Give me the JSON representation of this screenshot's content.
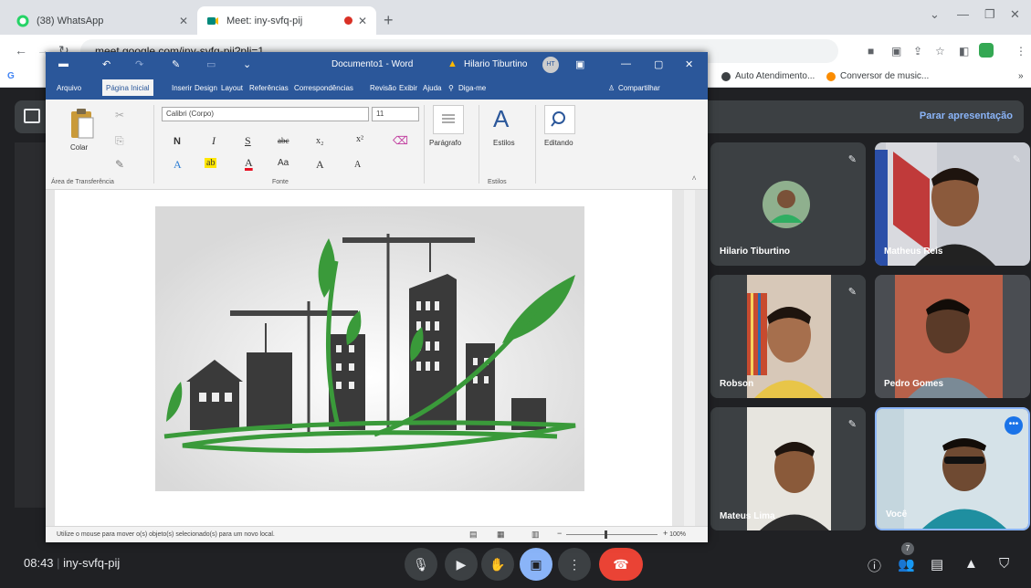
{
  "browser": {
    "tabs": [
      {
        "title": "(38) WhatsApp",
        "active": false
      },
      {
        "title": "Meet: iny-svfq-pij",
        "active": true
      }
    ],
    "new_tab": "+",
    "url": "meet.google.com/iny-svfq-pij?pli=1",
    "bookmarks": [
      "Auto Atendimento...",
      "Conversor de music..."
    ],
    "colors": {
      "tabbar": "#dee1e6",
      "recording": "#d93025"
    }
  },
  "meet": {
    "stop_presenting": "Parar apresentação",
    "time": "08:43",
    "meeting_code": "iny-svfq-pij",
    "participant_count": "7",
    "participants": [
      {
        "name": "Hilario Tiburtino"
      },
      {
        "name": "Matheus Reis"
      },
      {
        "name": "Robson"
      },
      {
        "name": "Pedro Gomes"
      },
      {
        "name": "Mateus Lima"
      },
      {
        "name": "Você"
      }
    ],
    "colors": {
      "background": "#202124",
      "tile": "#3c4043",
      "accent": "#8ab4f8",
      "end_call": "#ea4335"
    }
  },
  "word": {
    "title": "Documento1 - Word",
    "user": "Hilario Tiburtino",
    "user_initials": "HT",
    "tabs": [
      "Arquivo",
      "Página Inicial",
      "Inserir",
      "Design",
      "Layout",
      "Referências",
      "Correspondências",
      "Revisão",
      "Exibir",
      "Ajuda",
      "Diga-me",
      "Compartilhar"
    ],
    "selected_tab": "Página Inicial",
    "ribbon": {
      "paste": "Colar",
      "clipboard": "Área de Transferência",
      "font_name": "Calibri (Corpo)",
      "font_size": "11",
      "font_group": "Fonte",
      "paragraph": "Parágrafo",
      "styles": "Estilos",
      "styles_group": "Estilos",
      "editing": "Editando",
      "bold": "N",
      "italic": "I",
      "underline": "S",
      "strike": "abc",
      "subscript": "x₂",
      "superscript": "x²",
      "grow": "A",
      "shrink": "A",
      "case": "Aa"
    },
    "status_message": "Utilize o mouse para mover o(s) objeto(s) selecionado(s) para um novo local.",
    "zoom": "100%",
    "colors": {
      "brand": "#2b579a",
      "leaf": "#3a9a3a"
    }
  }
}
